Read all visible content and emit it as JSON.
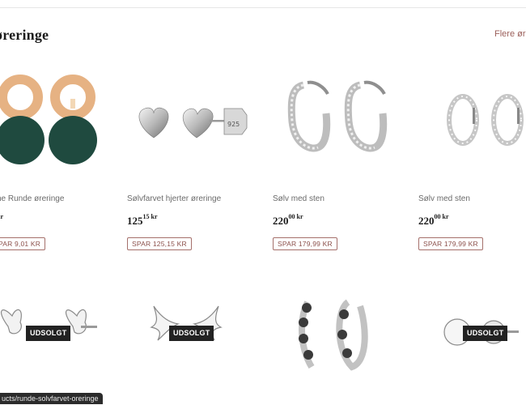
{
  "section": {
    "title": "øreringe",
    "more_link": "Flere øreringe"
  },
  "products_row1": [
    {
      "name": "he Runde øreringe",
      "price_main": "",
      "price_cents": "kr",
      "save": "PAR 9,01 KR"
    },
    {
      "name": "Sølvfarvet hjerter øreringe",
      "price_main": "125",
      "price_cents": "15 kr",
      "save": "SPAR 125,15 KR"
    },
    {
      "name": "Sølv med sten",
      "price_main": "220",
      "price_cents": "00 kr",
      "save": "SPAR 179,99 KR"
    },
    {
      "name": "Sølv med sten",
      "price_main": "220",
      "price_cents": "00 kr",
      "save": "SPAR 179,99 KR"
    }
  ],
  "products_row2": [
    {
      "badge": "UDSOLGT",
      "icon": "butterfly-earrings"
    },
    {
      "badge": "UDSOLGT",
      "icon": "swallow-earrings"
    },
    {
      "badge": "",
      "icon": "flower-hoop-earrings"
    },
    {
      "badge": "UDSOLGT",
      "icon": "disc-stud-earrings"
    }
  ],
  "status_bar": {
    "url": "ucts/runde-solvfarvet-oreringe"
  },
  "colors": {
    "accent": "#9b5f5a",
    "badge_bg": "#222222",
    "rose_gold": "#e6b283",
    "dark_green": "#1f4a3f"
  }
}
